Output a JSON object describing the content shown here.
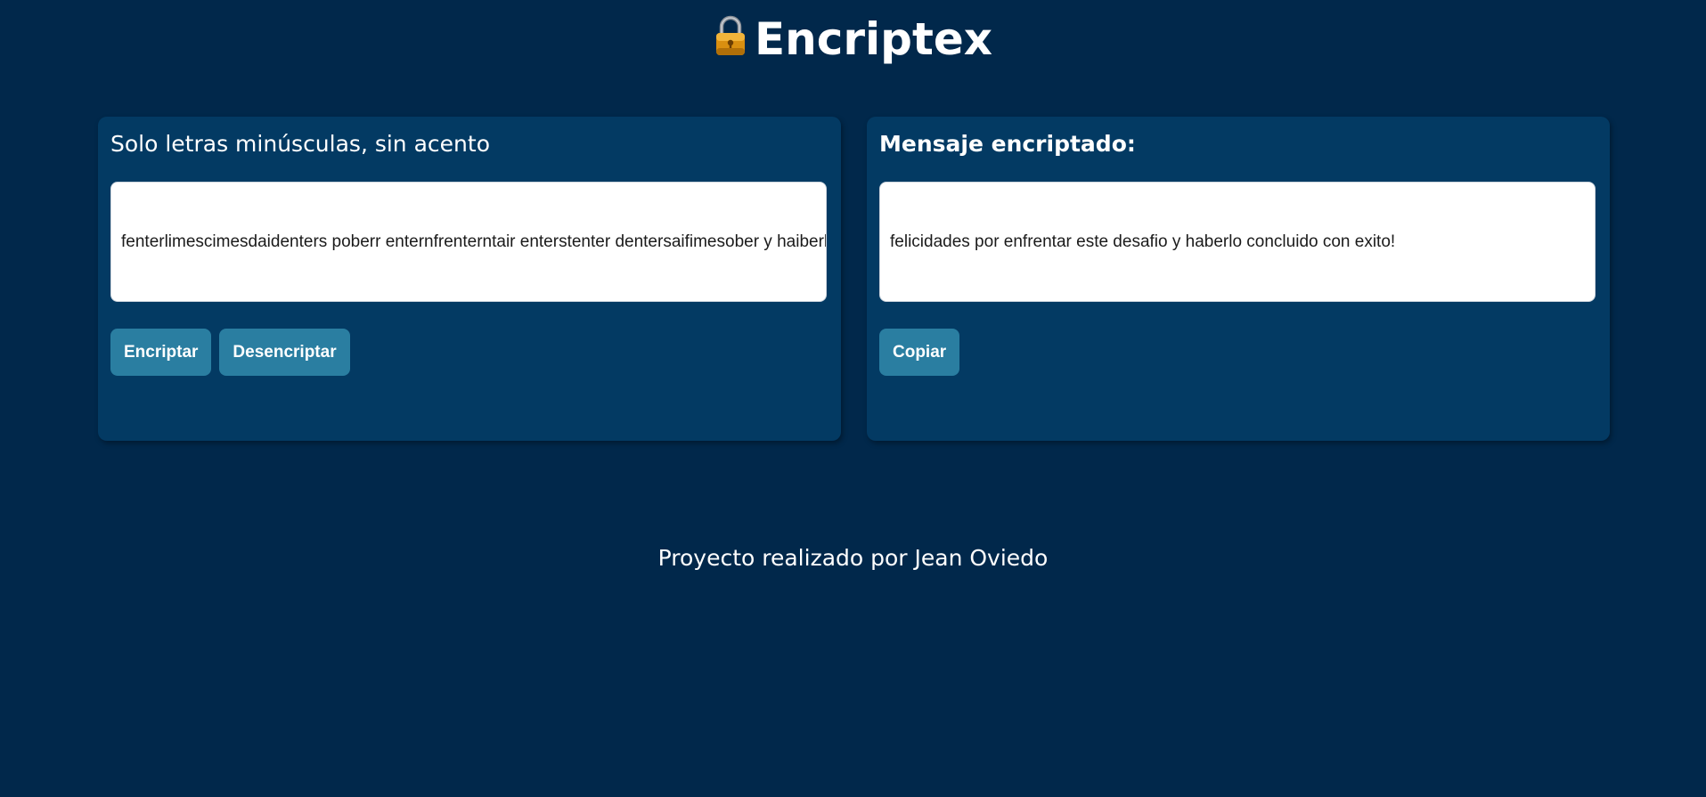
{
  "header": {
    "icon": "lock-icon",
    "title": "Encriptex"
  },
  "input_panel": {
    "heading": "Solo letras minúsculas, sin acento",
    "input_value": "fenterlimescimesdaidenters poberr enternfrenterntair enterstenter dentersaifimesober y haiberlober cobercluimesdober cobern enterximesober!",
    "buttons": {
      "encrypt_label": "Encriptar",
      "decrypt_label": "Desencriptar"
    }
  },
  "output_panel": {
    "heading": "Mensaje encriptado:",
    "output_value": "felicidades por enfrentar este desafio y haberlo concluido con exito!",
    "copy_label": "Copiar"
  },
  "footer": {
    "text": "Proyecto realizado por Jean Oviedo"
  },
  "colors": {
    "background": "#01284b",
    "panel": "#033a63",
    "button": "#2a7ea1",
    "text": "#ffffff"
  }
}
